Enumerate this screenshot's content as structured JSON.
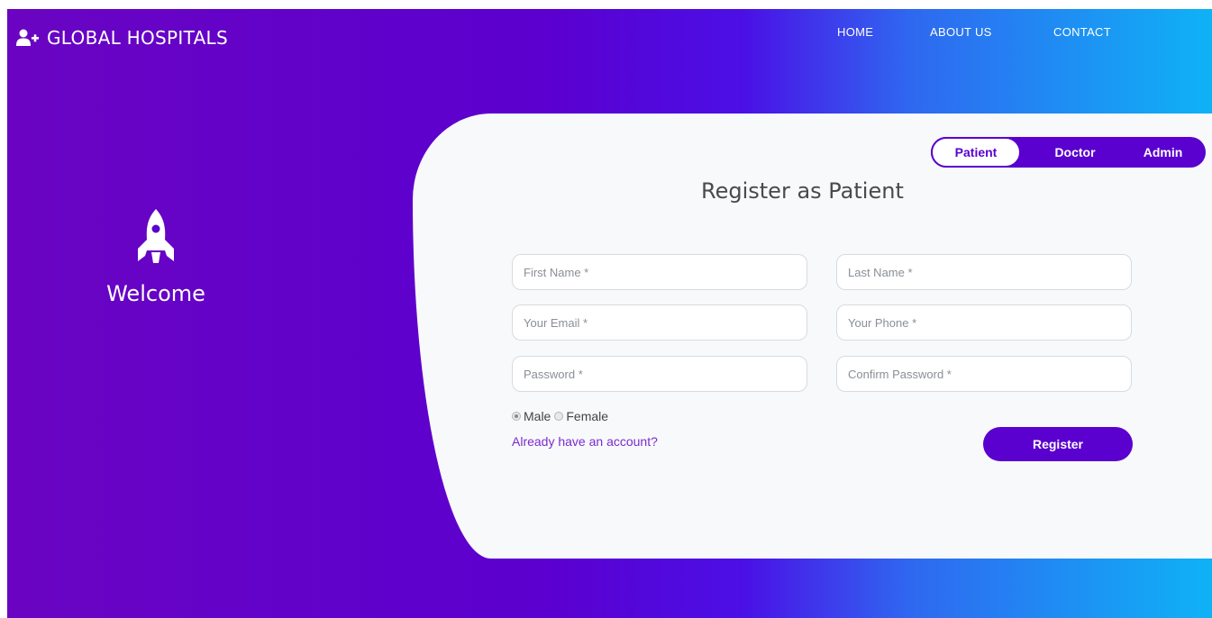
{
  "brand": {
    "name": "GLOBAL HOSPITALS",
    "icon": "user-plus-icon"
  },
  "nav": {
    "items": [
      {
        "label": "HOME"
      },
      {
        "label": "ABOUT US"
      },
      {
        "label": "CONTACT"
      }
    ]
  },
  "welcome": {
    "icon": "rocket-icon",
    "text": "Welcome"
  },
  "tabs": {
    "items": [
      {
        "label": "Patient",
        "active": true
      },
      {
        "label": "Doctor",
        "active": false
      },
      {
        "label": "Admin",
        "active": false
      }
    ]
  },
  "form": {
    "title": "Register as Patient",
    "fields": {
      "first_name": {
        "placeholder": "First Name *",
        "value": ""
      },
      "last_name": {
        "placeholder": "Last Name *",
        "value": ""
      },
      "email": {
        "placeholder": "Your Email *",
        "value": ""
      },
      "phone": {
        "placeholder": "Your Phone *",
        "value": ""
      },
      "password": {
        "placeholder": "Password *",
        "value": ""
      },
      "confirm_password": {
        "placeholder": "Confirm Password *",
        "value": ""
      }
    },
    "gender": {
      "options": [
        {
          "label": "Male",
          "checked": true
        },
        {
          "label": "Female",
          "checked": false
        }
      ]
    },
    "login_link": "Already have an account?",
    "submit_label": "Register"
  },
  "colors": {
    "brand_purple": "#5a00cf",
    "gradient_start": "#6a04c2",
    "gradient_end": "#0fb2f6",
    "card_background": "#f8f9fa",
    "link_purple": "#7b2bd0"
  }
}
